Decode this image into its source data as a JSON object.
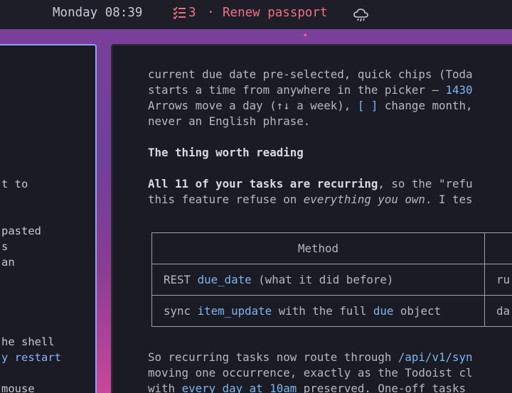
{
  "statusbar": {
    "clock": "Monday 08:39",
    "task_count": "3",
    "separator": "·",
    "task_title": "Renew passport",
    "task_icon": "task-list-icon",
    "weather_icon": "cloud-rain-icon",
    "accent_color": "#f07187"
  },
  "left_pane": {
    "lines": [
      "t to",
      "pasted",
      "s",
      "an",
      "he shell",
      "y restart",
      "mouse"
    ]
  },
  "main": {
    "p1": {
      "l1": "current due date pre-selected, quick chips (Toda",
      "l2a": "starts a time from anywhere in the picker — ",
      "l2b": "1430",
      "l3a": "Arrows move a day (↑↓ a week), ",
      "l3b": "[ ]",
      "l3c": " change month,",
      "l4": "never an English phrase."
    },
    "heading": "The thing worth reading",
    "p2": {
      "l1a": "All 11 of your tasks are recurring",
      "l1b": ", so the \"refu",
      "l2a": "this feature refuse on ",
      "l2b": "everything you own",
      "l2c": ". I tes"
    },
    "table": {
      "header": "Method",
      "header2": "",
      "rows": [
        {
          "pre": "REST ",
          "code": "due_date",
          "post": " (what it did before)",
          "col2": "ru"
        },
        {
          "pre": "sync ",
          "code": "item_update",
          "post": " with the full ",
          "code2": "due",
          "post2": " object",
          "col2": "da"
        }
      ]
    },
    "p3": {
      "l1a": "So recurring tasks now route through ",
      "l1b": "/api/v1/syn",
      "l2": "moving one occurrence, exactly as the Todoist cl",
      "l3a": "with ",
      "l3b": "every day at 10am",
      "l3c": " preserved. One-off tasks "
    }
  }
}
